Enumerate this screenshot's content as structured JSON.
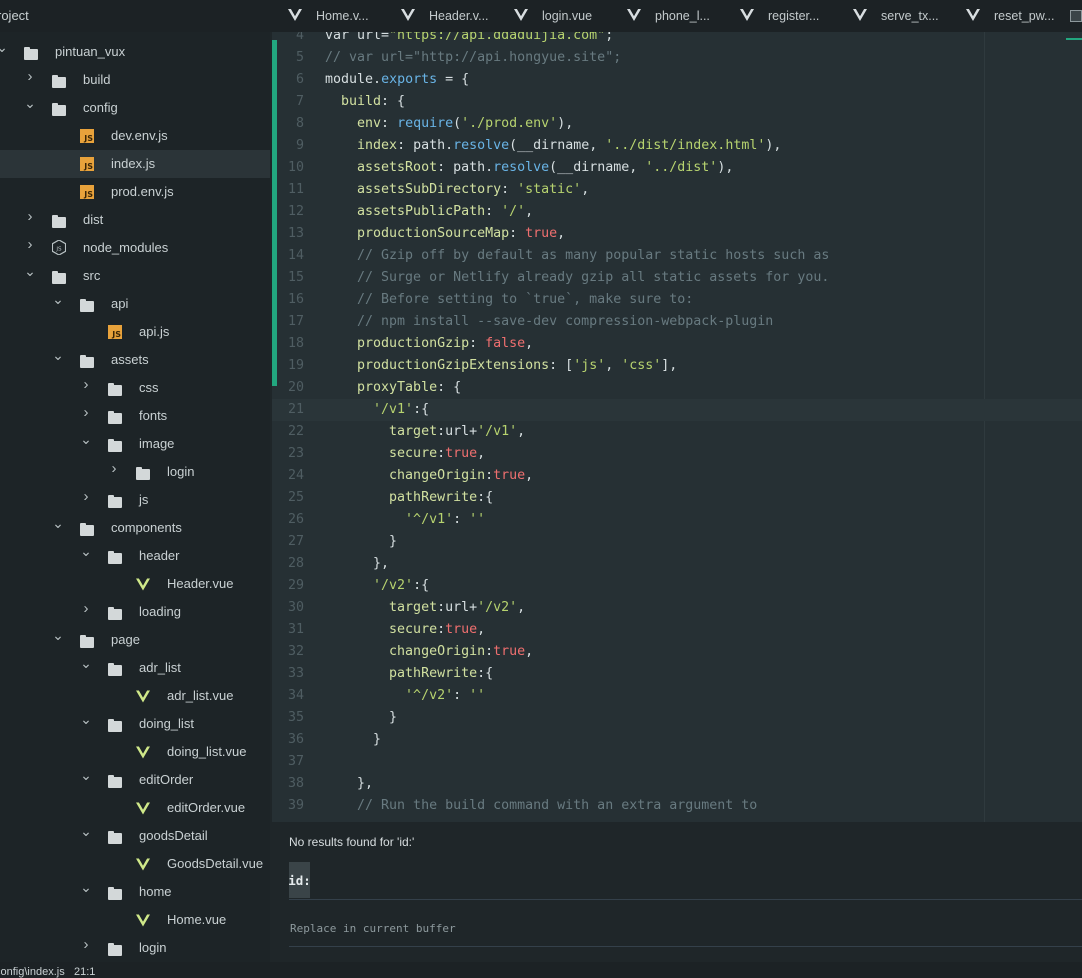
{
  "project_title": "roject",
  "tabs": [
    {
      "label": "Home.v..."
    },
    {
      "label": "Header.v..."
    },
    {
      "label": "login.vue"
    },
    {
      "label": "phone_l..."
    },
    {
      "label": "register..."
    },
    {
      "label": "serve_tx..."
    },
    {
      "label": "reset_pw..."
    }
  ],
  "tree": [
    {
      "label": "pintuan_vux",
      "depth": 0,
      "type": "folder",
      "chevron": "down"
    },
    {
      "label": "build",
      "depth": 1,
      "type": "folder",
      "chevron": "right"
    },
    {
      "label": "config",
      "depth": 1,
      "type": "folder",
      "chevron": "down"
    },
    {
      "label": "dev.env.js",
      "depth": 2,
      "type": "js",
      "chevron": ""
    },
    {
      "label": "index.js",
      "depth": 2,
      "type": "js",
      "chevron": "",
      "selected": true
    },
    {
      "label": "prod.env.js",
      "depth": 2,
      "type": "js",
      "chevron": ""
    },
    {
      "label": "dist",
      "depth": 1,
      "type": "folder",
      "chevron": "right"
    },
    {
      "label": "node_modules",
      "depth": 1,
      "type": "node",
      "chevron": "right"
    },
    {
      "label": "src",
      "depth": 1,
      "type": "folder",
      "chevron": "down"
    },
    {
      "label": "api",
      "depth": 2,
      "type": "folder",
      "chevron": "down"
    },
    {
      "label": "api.js",
      "depth": 3,
      "type": "js",
      "chevron": ""
    },
    {
      "label": "assets",
      "depth": 2,
      "type": "folder",
      "chevron": "down"
    },
    {
      "label": "css",
      "depth": 3,
      "type": "folder",
      "chevron": "right"
    },
    {
      "label": "fonts",
      "depth": 3,
      "type": "folder",
      "chevron": "right"
    },
    {
      "label": "image",
      "depth": 3,
      "type": "folder",
      "chevron": "down"
    },
    {
      "label": "login",
      "depth": 4,
      "type": "folder",
      "chevron": "right"
    },
    {
      "label": "js",
      "depth": 3,
      "type": "folder",
      "chevron": "right"
    },
    {
      "label": "components",
      "depth": 2,
      "type": "folder",
      "chevron": "down"
    },
    {
      "label": "header",
      "depth": 3,
      "type": "folder",
      "chevron": "down"
    },
    {
      "label": "Header.vue",
      "depth": 4,
      "type": "vue",
      "chevron": ""
    },
    {
      "label": "loading",
      "depth": 3,
      "type": "folder",
      "chevron": "right"
    },
    {
      "label": "page",
      "depth": 2,
      "type": "folder",
      "chevron": "down"
    },
    {
      "label": "adr_list",
      "depth": 3,
      "type": "folder",
      "chevron": "down"
    },
    {
      "label": "adr_list.vue",
      "depth": 4,
      "type": "vue",
      "chevron": ""
    },
    {
      "label": "doing_list",
      "depth": 3,
      "type": "folder",
      "chevron": "down"
    },
    {
      "label": "doing_list.vue",
      "depth": 4,
      "type": "vue",
      "chevron": ""
    },
    {
      "label": "editOrder",
      "depth": 3,
      "type": "folder",
      "chevron": "down"
    },
    {
      "label": "editOrder.vue",
      "depth": 4,
      "type": "vue",
      "chevron": ""
    },
    {
      "label": "goodsDetail",
      "depth": 3,
      "type": "folder",
      "chevron": "down"
    },
    {
      "label": "GoodsDetail.vue",
      "depth": 4,
      "type": "vue",
      "chevron": ""
    },
    {
      "label": "home",
      "depth": 3,
      "type": "folder",
      "chevron": "down"
    },
    {
      "label": "Home.vue",
      "depth": 4,
      "type": "vue",
      "chevron": ""
    },
    {
      "label": "login",
      "depth": 3,
      "type": "folder",
      "chevron": "right"
    }
  ],
  "editor": {
    "current_line": 21,
    "lines": [
      {
        "n": "4",
        "tokens": [
          [
            "t-kw",
            "var url="
          ],
          [
            "t-str",
            "\"https://api.ddaduijia.com\""
          ],
          [
            "t-punct",
            ";"
          ]
        ]
      },
      {
        "n": "5",
        "tokens": [
          [
            "t-cmt",
            "// var url=\"http://api.hongyue.site\";"
          ]
        ]
      },
      {
        "n": "6",
        "tokens": [
          [
            "t-kw",
            "module"
          ],
          [
            "t-punct",
            "."
          ],
          [
            "t-fn",
            "exports"
          ],
          [
            "t-punct",
            " = {"
          ]
        ]
      },
      {
        "n": "7",
        "tokens": [
          [
            "t-key",
            "  build"
          ],
          [
            "t-punct",
            ": {"
          ]
        ]
      },
      {
        "n": "8",
        "tokens": [
          [
            "t-key",
            "    env"
          ],
          [
            "t-punct",
            ": "
          ],
          [
            "t-fn",
            "require"
          ],
          [
            "t-punct",
            "("
          ],
          [
            "t-str",
            "'./prod.env'"
          ],
          [
            "t-punct",
            "),"
          ]
        ]
      },
      {
        "n": "9",
        "tokens": [
          [
            "t-key",
            "    index"
          ],
          [
            "t-punct",
            ": path."
          ],
          [
            "t-fn",
            "resolve"
          ],
          [
            "t-punct",
            "(__dirname, "
          ],
          [
            "t-str",
            "'../dist/index.html'"
          ],
          [
            "t-punct",
            "),"
          ]
        ]
      },
      {
        "n": "10",
        "tokens": [
          [
            "t-key",
            "    assetsRoot"
          ],
          [
            "t-punct",
            ": path."
          ],
          [
            "t-fn",
            "resolve"
          ],
          [
            "t-punct",
            "(__dirname, "
          ],
          [
            "t-str",
            "'../dist'"
          ],
          [
            "t-punct",
            "),"
          ]
        ]
      },
      {
        "n": "11",
        "tokens": [
          [
            "t-key",
            "    assetsSubDirectory"
          ],
          [
            "t-punct",
            ": "
          ],
          [
            "t-str",
            "'static'"
          ],
          [
            "t-punct",
            ","
          ]
        ]
      },
      {
        "n": "12",
        "tokens": [
          [
            "t-key",
            "    assetsPublicPath"
          ],
          [
            "t-punct",
            ": "
          ],
          [
            "t-str",
            "'/'"
          ],
          [
            "t-punct",
            ","
          ]
        ]
      },
      {
        "n": "13",
        "tokens": [
          [
            "t-key",
            "    productionSourceMap"
          ],
          [
            "t-punct",
            ": "
          ],
          [
            "t-bool",
            "true"
          ],
          [
            "t-punct",
            ","
          ]
        ]
      },
      {
        "n": "14",
        "tokens": [
          [
            "t-cmt",
            "    // Gzip off by default as many popular static hosts such as"
          ]
        ]
      },
      {
        "n": "15",
        "tokens": [
          [
            "t-cmt",
            "    // Surge or Netlify already gzip all static assets for you."
          ]
        ]
      },
      {
        "n": "16",
        "tokens": [
          [
            "t-cmt",
            "    // Before setting to `true`, make sure to:"
          ]
        ]
      },
      {
        "n": "17",
        "tokens": [
          [
            "t-cmt",
            "    // npm install --save-dev compression-webpack-plugin"
          ]
        ]
      },
      {
        "n": "18",
        "tokens": [
          [
            "t-key",
            "    productionGzip"
          ],
          [
            "t-punct",
            ": "
          ],
          [
            "t-bool",
            "false"
          ],
          [
            "t-punct",
            ","
          ]
        ]
      },
      {
        "n": "19",
        "tokens": [
          [
            "t-key",
            "    productionGzipExtensions"
          ],
          [
            "t-punct",
            ": ["
          ],
          [
            "t-str",
            "'js'"
          ],
          [
            "t-punct",
            ", "
          ],
          [
            "t-str",
            "'css'"
          ],
          [
            "t-punct",
            "],"
          ]
        ]
      },
      {
        "n": "20",
        "tokens": [
          [
            "t-key",
            "    proxyTable"
          ],
          [
            "t-punct",
            ": {"
          ]
        ]
      },
      {
        "n": "21",
        "tokens": [
          [
            "t-str",
            "      '/v1'"
          ],
          [
            "t-punct",
            ":{"
          ]
        ]
      },
      {
        "n": "22",
        "tokens": [
          [
            "t-key",
            "        target"
          ],
          [
            "t-punct",
            ":url+"
          ],
          [
            "t-str",
            "'/v1'"
          ],
          [
            "t-punct",
            ","
          ]
        ]
      },
      {
        "n": "23",
        "tokens": [
          [
            "t-key",
            "        secure"
          ],
          [
            "t-punct",
            ":"
          ],
          [
            "t-bool",
            "true"
          ],
          [
            "t-punct",
            ","
          ]
        ]
      },
      {
        "n": "24",
        "tokens": [
          [
            "t-key",
            "        changeOrigin"
          ],
          [
            "t-punct",
            ":"
          ],
          [
            "t-bool",
            "true"
          ],
          [
            "t-punct",
            ","
          ]
        ]
      },
      {
        "n": "25",
        "tokens": [
          [
            "t-key",
            "        pathRewrite"
          ],
          [
            "t-punct",
            ":{"
          ]
        ]
      },
      {
        "n": "26",
        "tokens": [
          [
            "t-str",
            "          '^/v1'"
          ],
          [
            "t-punct",
            ": "
          ],
          [
            "t-str",
            "''"
          ]
        ]
      },
      {
        "n": "27",
        "tokens": [
          [
            "t-punct",
            "        }"
          ]
        ]
      },
      {
        "n": "28",
        "tokens": [
          [
            "t-punct",
            "      },"
          ]
        ]
      },
      {
        "n": "29",
        "tokens": [
          [
            "t-str",
            "      '/v2'"
          ],
          [
            "t-punct",
            ":{"
          ]
        ]
      },
      {
        "n": "30",
        "tokens": [
          [
            "t-key",
            "        target"
          ],
          [
            "t-punct",
            ":url+"
          ],
          [
            "t-str",
            "'/v2'"
          ],
          [
            "t-punct",
            ","
          ]
        ]
      },
      {
        "n": "31",
        "tokens": [
          [
            "t-key",
            "        secure"
          ],
          [
            "t-punct",
            ":"
          ],
          [
            "t-bool",
            "true"
          ],
          [
            "t-punct",
            ","
          ]
        ]
      },
      {
        "n": "32",
        "tokens": [
          [
            "t-key",
            "        changeOrigin"
          ],
          [
            "t-punct",
            ":"
          ],
          [
            "t-bool",
            "true"
          ],
          [
            "t-punct",
            ","
          ]
        ]
      },
      {
        "n": "33",
        "tokens": [
          [
            "t-key",
            "        pathRewrite"
          ],
          [
            "t-punct",
            ":{"
          ]
        ]
      },
      {
        "n": "34",
        "tokens": [
          [
            "t-str",
            "          '^/v2'"
          ],
          [
            "t-punct",
            ": "
          ],
          [
            "t-str",
            "''"
          ]
        ]
      },
      {
        "n": "35",
        "tokens": [
          [
            "t-punct",
            "        }"
          ]
        ]
      },
      {
        "n": "36",
        "tokens": [
          [
            "t-punct",
            "      }"
          ]
        ]
      },
      {
        "n": "37",
        "tokens": []
      },
      {
        "n": "38",
        "tokens": [
          [
            "t-punct",
            "    },"
          ]
        ]
      },
      {
        "n": "39",
        "tokens": [
          [
            "t-cmt",
            "    // Run the build command with an extra argument to"
          ]
        ]
      }
    ]
  },
  "find": {
    "message": "No results found for 'id:'",
    "input_value": "id:",
    "replace_placeholder": "Replace in current buffer"
  },
  "status": {
    "path": "config\\index.js",
    "position": "21:1"
  }
}
